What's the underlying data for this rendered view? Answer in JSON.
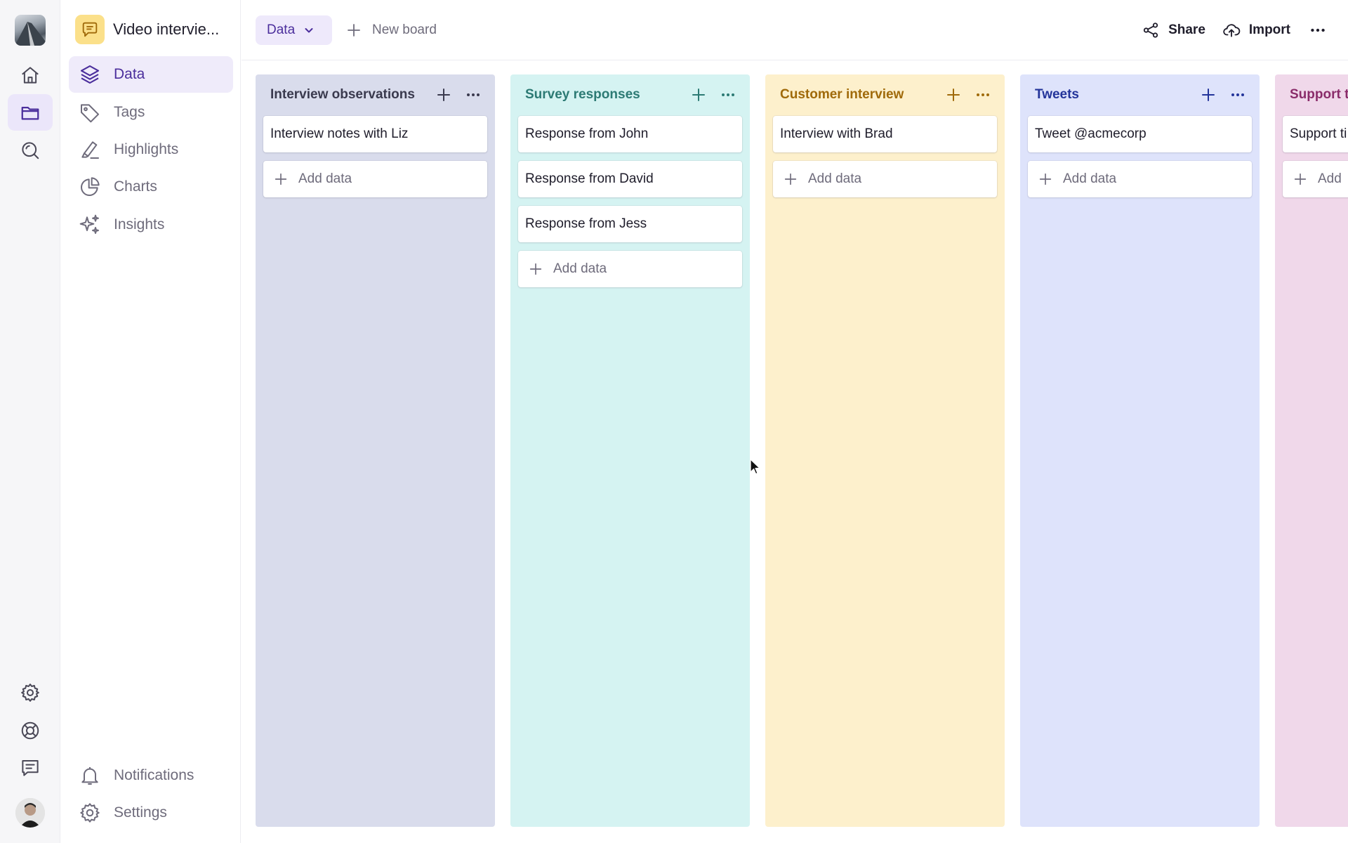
{
  "workspace": {
    "logo_icon": "workspace-logo",
    "avatar_icon": "user-avatar"
  },
  "rail": {
    "items": [
      {
        "name": "home",
        "icon": "home-icon"
      },
      {
        "name": "projects",
        "icon": "folder-icon",
        "active": true
      },
      {
        "name": "search",
        "icon": "search-icon"
      },
      {
        "name": "settings",
        "icon": "gear-icon"
      },
      {
        "name": "help",
        "icon": "lifebuoy-icon"
      },
      {
        "name": "feedback",
        "icon": "chat-icon"
      }
    ]
  },
  "project": {
    "title": "Video intervie...",
    "icon": "speech-bubble-icon",
    "icon_color": "#fbe08a"
  },
  "nav": {
    "items": [
      {
        "label": "Data",
        "icon": "layers-icon",
        "active": true
      },
      {
        "label": "Tags",
        "icon": "tag-icon"
      },
      {
        "label": "Highlights",
        "icon": "highlighter-icon"
      },
      {
        "label": "Charts",
        "icon": "pie-chart-icon"
      },
      {
        "label": "Insights",
        "icon": "sparkles-icon"
      }
    ],
    "bottom": [
      {
        "label": "Notifications",
        "icon": "bell-icon"
      },
      {
        "label": "Settings",
        "icon": "gear-icon"
      }
    ]
  },
  "topbar": {
    "board_select": "Data",
    "new_board": "New board",
    "share": "Share",
    "import": "Import"
  },
  "columns": [
    {
      "title": "Interview observations",
      "bg": "#d9dcec",
      "accent": "#3a3a4e",
      "cards": [
        "Interview notes with Liz"
      ],
      "add_label": "Add data"
    },
    {
      "title": "Survey responses",
      "bg": "#d5f3f2",
      "accent": "#2c7a74",
      "cards": [
        "Response from John",
        "Response from David",
        "Response from Jess"
      ],
      "add_label": "Add data"
    },
    {
      "title": "Customer interview",
      "bg": "#fdf0cc",
      "accent": "#a06a0a",
      "cards": [
        "Interview with Brad"
      ],
      "add_label": "Add data"
    },
    {
      "title": "Tweets",
      "bg": "#dee3fb",
      "accent": "#23349a",
      "cards": [
        "Tweet @acmecorp"
      ],
      "add_label": "Add data"
    },
    {
      "title": "Support t",
      "bg": "#f0d8ea",
      "accent": "#8a2c6a",
      "cards": [
        "Support ti"
      ],
      "add_label": "Add"
    }
  ]
}
